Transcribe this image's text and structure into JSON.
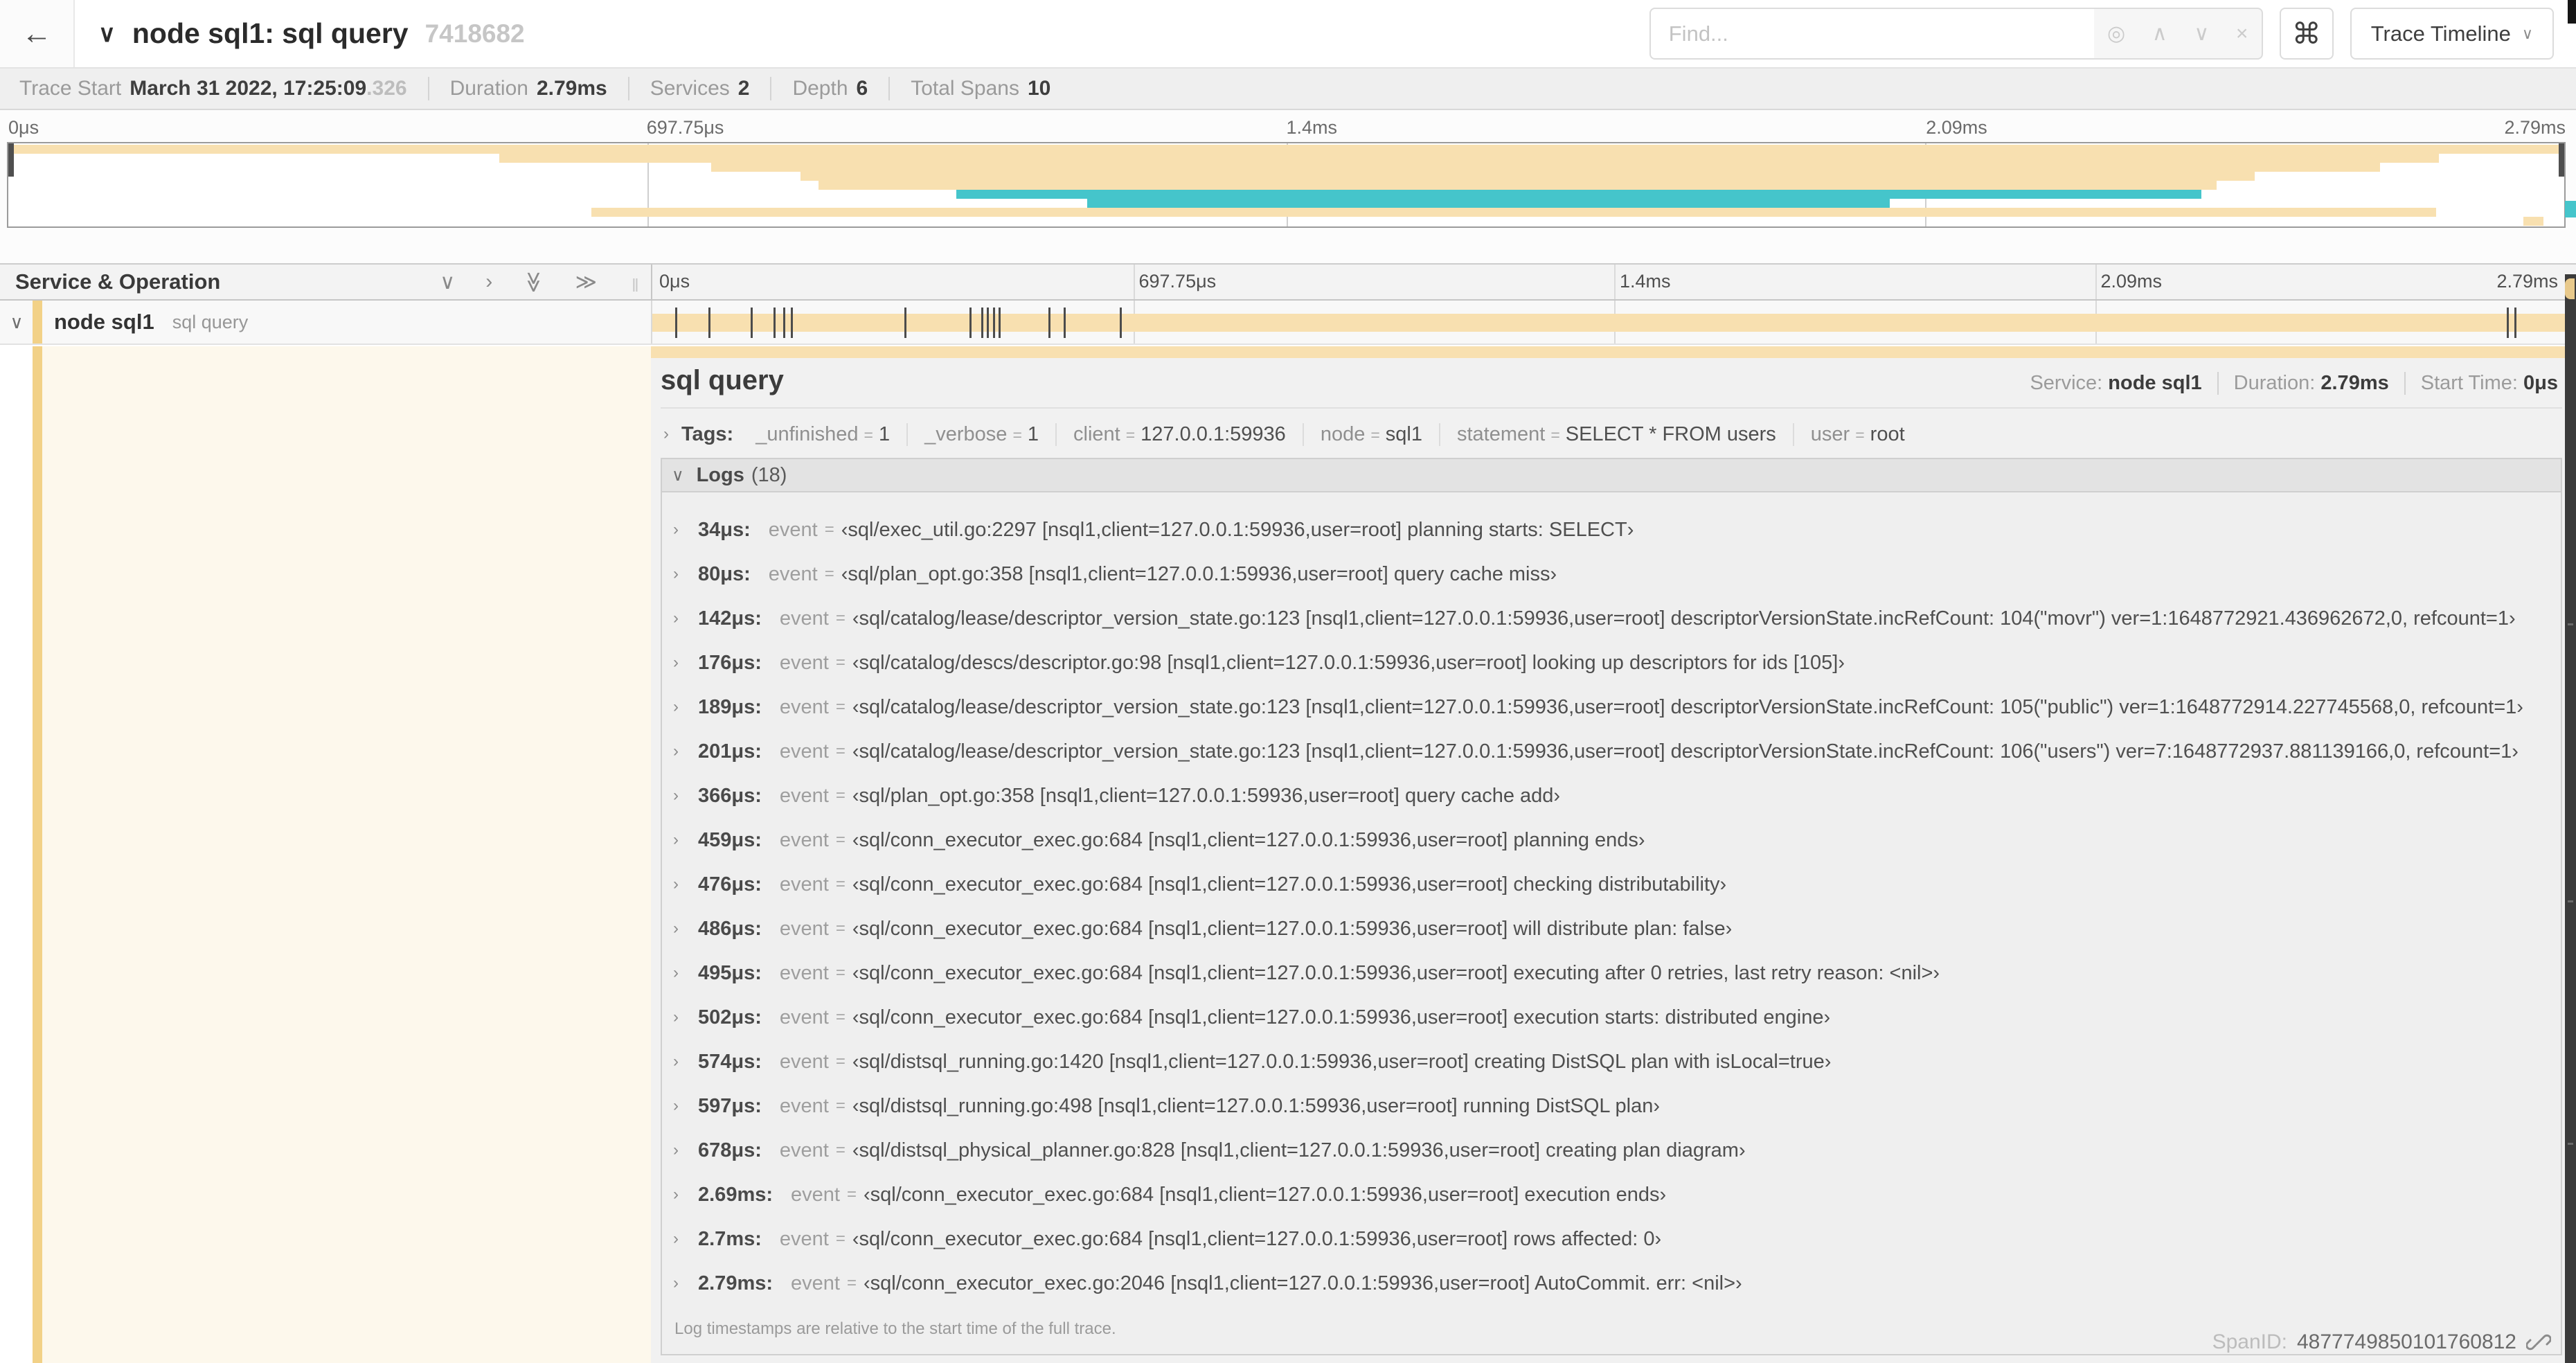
{
  "icons": {
    "back": "←",
    "chevron_down": "∨",
    "chevron_right": "›",
    "double_chevron": "≫",
    "find_target": "◎",
    "find_prev": "∧",
    "find_next": "∨",
    "find_clear": "×",
    "command": "⌘",
    "caret_down": "∨",
    "grip": "‖"
  },
  "header": {
    "title": "node sql1: sql query",
    "trace_id": "7418682",
    "find_placeholder": "Find...",
    "view_selector_label": "Trace Timeline"
  },
  "trace_stats": {
    "trace_start_label": "Trace Start",
    "trace_start_value": "March 31 2022, 17:25:09",
    "trace_start_fraction": ".326",
    "duration_label": "Duration",
    "duration_value": "2.79ms",
    "services_label": "Services",
    "services_value": "2",
    "depth_label": "Depth",
    "depth_value": "6",
    "total_spans_label": "Total Spans",
    "total_spans_value": "10"
  },
  "colors": {
    "tan": "#f8e0b0",
    "teal": "#45c5cb",
    "stripe": "#f2d187"
  },
  "minimap": {
    "ticks": [
      "0μs",
      "697.75μs",
      "1.4ms",
      "2.09ms",
      "2.79ms"
    ],
    "spans": [
      {
        "row": 0,
        "start": 0,
        "end": 100,
        "color": "tan"
      },
      {
        "row": 1,
        "start": 19.2,
        "end": 95.1,
        "color": "tan"
      },
      {
        "row": 2,
        "start": 27.5,
        "end": 92.8,
        "color": "tan"
      },
      {
        "row": 3,
        "start": 31.0,
        "end": 87.9,
        "color": "tan"
      },
      {
        "row": 4,
        "start": 31.7,
        "end": 86.4,
        "color": "tan"
      },
      {
        "row": 5,
        "start": 37.1,
        "end": 85.8,
        "color": "teal"
      },
      {
        "row": 6,
        "start": 42.2,
        "end": 73.6,
        "color": "teal"
      },
      {
        "row": 7,
        "start": 22.8,
        "end": 95.0,
        "color": "tan"
      },
      {
        "row": 8,
        "start": 98.4,
        "end": 99.2,
        "color": "tan"
      }
    ]
  },
  "timeline": {
    "header_label": "Service & Operation",
    "ticks": [
      "0μs",
      "697.75μs",
      "1.4ms",
      "2.09ms",
      "2.79ms"
    ],
    "row": {
      "service": "node sql1",
      "operation": "sql query"
    }
  },
  "detail": {
    "title": "sql query",
    "eq": "=",
    "meta": [
      {
        "label": "Service:",
        "value": "node sql1"
      },
      {
        "label": "Duration:",
        "value": "2.79ms"
      },
      {
        "label": "Start Time:",
        "value": "0μs"
      }
    ],
    "tags_label": "Tags:",
    "tags": [
      {
        "key": "_unfinished",
        "value": "1"
      },
      {
        "key": "_verbose",
        "value": "1"
      },
      {
        "key": "client",
        "value": "127.0.0.1:59936"
      },
      {
        "key": "node",
        "value": "sql1"
      },
      {
        "key": "statement",
        "value": "SELECT * FROM users"
      },
      {
        "key": "user",
        "value": "root"
      }
    ],
    "logs_label": "Logs",
    "logs_count": "(18)",
    "logs": [
      {
        "time": "34μs:",
        "field": "event",
        "pct": 1.2,
        "value": "‹sql/exec_util.go:2297 [nsql1,client=127.0.0.1:59936,user=root] planning starts: SELECT›"
      },
      {
        "time": "80μs:",
        "field": "event",
        "pct": 2.9,
        "value": "‹sql/plan_opt.go:358 [nsql1,client=127.0.0.1:59936,user=root] query cache miss›"
      },
      {
        "time": "142μs:",
        "field": "event",
        "pct": 5.1,
        "value": "‹sql/catalog/lease/descriptor_version_state.go:123 [nsql1,client=127.0.0.1:59936,user=root] descriptorVersionState.incRefCount: 104(\"movr\") ver=1:1648772921.436962672,0, refcount=1›"
      },
      {
        "time": "176μs:",
        "field": "event",
        "pct": 6.3,
        "value": "‹sql/catalog/descs/descriptor.go:98 [nsql1,client=127.0.0.1:59936,user=root] looking up descriptors for ids [105]›"
      },
      {
        "time": "189μs:",
        "field": "event",
        "pct": 6.8,
        "value": "‹sql/catalog/lease/descriptor_version_state.go:123 [nsql1,client=127.0.0.1:59936,user=root] descriptorVersionState.incRefCount: 105(\"public\") ver=1:1648772914.227745568,0, refcount=1›"
      },
      {
        "time": "201μs:",
        "field": "event",
        "pct": 7.2,
        "value": "‹sql/catalog/lease/descriptor_version_state.go:123 [nsql1,client=127.0.0.1:59936,user=root] descriptorVersionState.incRefCount: 106(\"users\") ver=7:1648772937.881139166,0, refcount=1›"
      },
      {
        "time": "366μs:",
        "field": "event",
        "pct": 13.1,
        "value": "‹sql/plan_opt.go:358 [nsql1,client=127.0.0.1:59936,user=root] query cache add›"
      },
      {
        "time": "459μs:",
        "field": "event",
        "pct": 16.5,
        "value": "‹sql/conn_executor_exec.go:684 [nsql1,client=127.0.0.1:59936,user=root] planning ends›"
      },
      {
        "time": "476μs:",
        "field": "event",
        "pct": 17.1,
        "value": "‹sql/conn_executor_exec.go:684 [nsql1,client=127.0.0.1:59936,user=root] checking distributability›"
      },
      {
        "time": "486μs:",
        "field": "event",
        "pct": 17.4,
        "value": "‹sql/conn_executor_exec.go:684 [nsql1,client=127.0.0.1:59936,user=root] will distribute plan: false›"
      },
      {
        "time": "495μs:",
        "field": "event",
        "pct": 17.7,
        "value": "‹sql/conn_executor_exec.go:684 [nsql1,client=127.0.0.1:59936,user=root] executing after 0 retries, last retry reason: <nil>›"
      },
      {
        "time": "502μs:",
        "field": "event",
        "pct": 18.0,
        "value": "‹sql/conn_executor_exec.go:684 [nsql1,client=127.0.0.1:59936,user=root] execution starts: distributed engine›"
      },
      {
        "time": "574μs:",
        "field": "event",
        "pct": 20.6,
        "value": "‹sql/distsql_running.go:1420 [nsql1,client=127.0.0.1:59936,user=root] creating DistSQL plan with isLocal=true›"
      },
      {
        "time": "597μs:",
        "field": "event",
        "pct": 21.4,
        "value": "‹sql/distsql_running.go:498 [nsql1,client=127.0.0.1:59936,user=root] running DistSQL plan›"
      },
      {
        "time": "678μs:",
        "field": "event",
        "pct": 24.3,
        "value": "‹sql/distsql_physical_planner.go:828 [nsql1,client=127.0.0.1:59936,user=root] creating plan diagram›"
      },
      {
        "time": "2.69ms:",
        "field": "event",
        "pct": 96.4,
        "value": "‹sql/conn_executor_exec.go:684 [nsql1,client=127.0.0.1:59936,user=root] execution ends›"
      },
      {
        "time": "2.7ms:",
        "field": "event",
        "pct": 96.8,
        "value": "‹sql/conn_executor_exec.go:684 [nsql1,client=127.0.0.1:59936,user=root] rows affected: 0›"
      },
      {
        "time": "2.79ms:",
        "field": "event",
        "pct": 99.8,
        "value": "‹sql/conn_executor_exec.go:2046 [nsql1,client=127.0.0.1:59936,user=root] AutoCommit. err: <nil>›"
      }
    ],
    "logs_note": "Log timestamps are relative to the start time of the full trace.",
    "span_id_label": "SpanID:",
    "span_id": "4877749850101760812"
  }
}
